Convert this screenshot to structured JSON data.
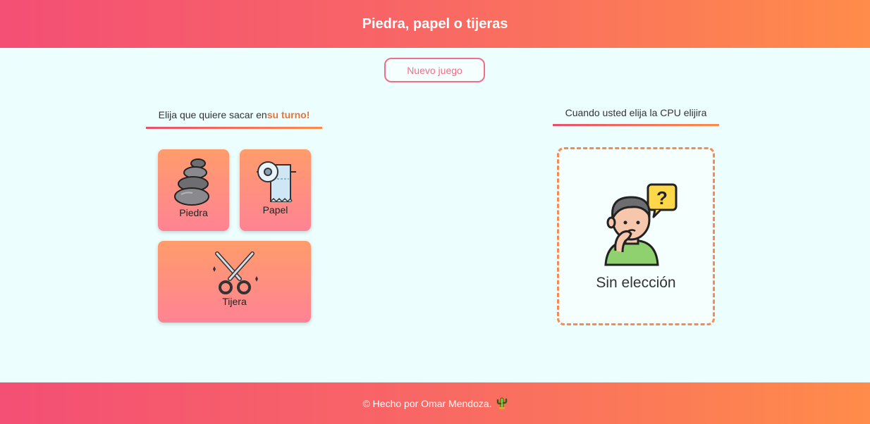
{
  "header": {
    "title": "Piedra, papel o tijeras"
  },
  "toolbar": {
    "new_game_label": "Nuevo juego"
  },
  "player": {
    "prompt_text": "Elija que quiere sacar en",
    "prompt_accent": "su turno!",
    "choices": [
      {
        "label": "Piedra",
        "icon": "stones-icon"
      },
      {
        "label": "Papel",
        "icon": "toilet-paper-icon"
      },
      {
        "label": "Tijera",
        "icon": "scissors-icon"
      }
    ]
  },
  "cpu": {
    "title": "Cuando usted elija la CPU elijira",
    "result_label": "Sin elección",
    "icon": "thinking-boy-icon"
  },
  "footer": {
    "text": "© Hecho por Omar Mendoza.",
    "icon": "cactus-icon"
  },
  "colors": {
    "gradient_start": "#f44f74",
    "gradient_end": "#ff8c4a",
    "background": "#ecfffe",
    "accent_orange": "#e8753a",
    "button_pink": "#f06e86"
  }
}
